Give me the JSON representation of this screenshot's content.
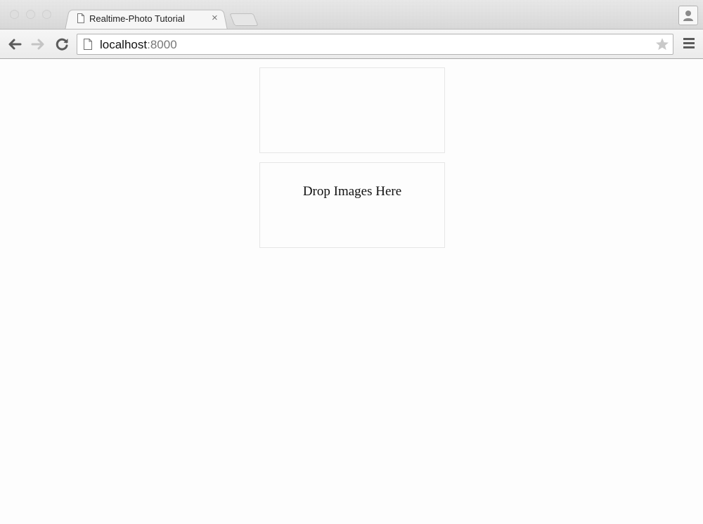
{
  "browser": {
    "tab": {
      "title": "Realtime-Photo Tutorial",
      "close_glyph": "×",
      "favicon": "page-icon"
    },
    "address_bar": {
      "host": "localhost",
      "port": ":8000"
    },
    "icons": {
      "back": "back-arrow-icon",
      "forward": "forward-arrow-icon",
      "reload": "reload-icon",
      "bookmark": "star-icon",
      "menu": "hamburger-menu-icon",
      "profile": "person-icon"
    },
    "colors": {
      "window_chrome": "#dcdcdc",
      "page_background": "#fdfdfd",
      "panel_border": "#e6e6e6"
    }
  },
  "page": {
    "drop_zone": {
      "label": "Drop Images Here"
    }
  }
}
